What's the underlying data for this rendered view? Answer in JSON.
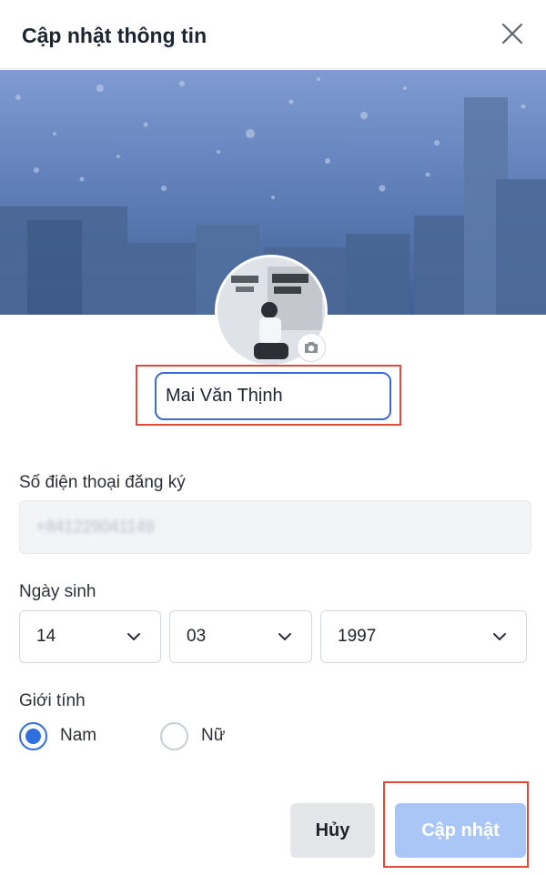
{
  "dialog": {
    "title": "Cập nhật thông tin",
    "close_icon": "close-icon"
  },
  "profile": {
    "cover_image": "rainy-city-cover",
    "avatar_image": "profile-photo",
    "camera_icon": "camera-icon",
    "display_name": "Mai Văn Thịnh"
  },
  "form": {
    "phone_label": "Số điện thoại đăng ký",
    "phone_value": "+841229041149",
    "birthday_label": "Ngày sinh",
    "birthday": {
      "day": "14",
      "month": "03",
      "year": "1997"
    },
    "gender_label": "Giới tính",
    "gender_options": [
      {
        "label": "Nam",
        "selected": true
      },
      {
        "label": "Nữ",
        "selected": false
      }
    ]
  },
  "actions": {
    "cancel_label": "Hủy",
    "submit_label": "Cập nhật"
  },
  "colors": {
    "accent": "#2f6fe0",
    "submit_disabled": "#a9c6f6",
    "highlight": "#e04a3b"
  }
}
